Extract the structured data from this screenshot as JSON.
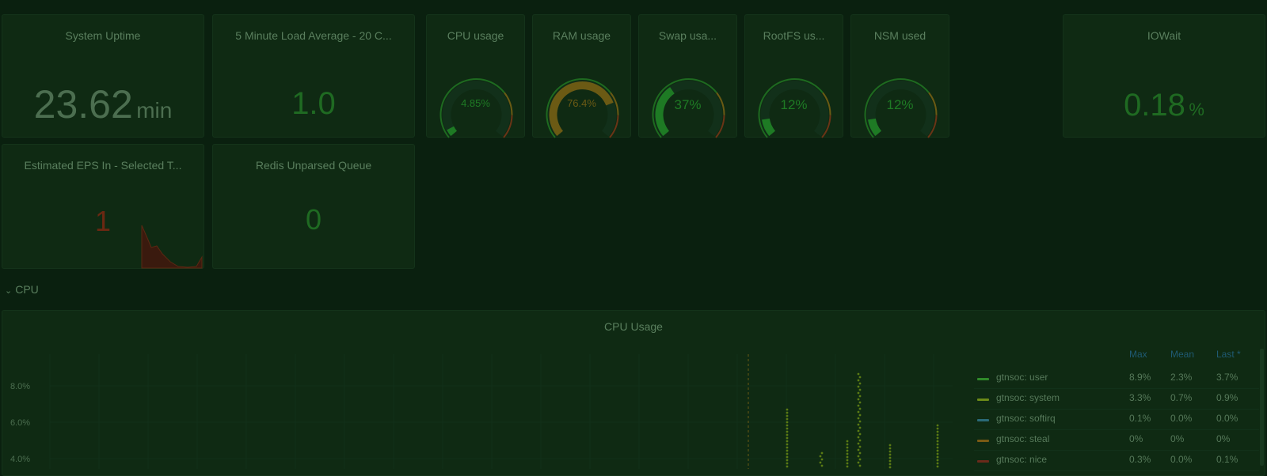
{
  "stats": {
    "uptime": {
      "title": "System Uptime",
      "value": "23.62",
      "unit": "min"
    },
    "load": {
      "title": "5 Minute Load Average - 20 C...",
      "value": "1.0"
    },
    "iowait": {
      "title": "IOWait",
      "value": "0.18",
      "unit": "%"
    },
    "eps": {
      "title": "Estimated EPS In - Selected T...",
      "value": "1"
    },
    "redis": {
      "title": "Redis Unparsed Queue",
      "value": "0"
    }
  },
  "gauges": [
    {
      "title": "CPU usage",
      "value": "4.85%",
      "level": 0.0485,
      "color": "#1e7a24"
    },
    {
      "title": "RAM usage",
      "value": "76.4%",
      "level": 0.764,
      "color": "#6b5a14"
    },
    {
      "title": "Swap usa...",
      "value": "37%",
      "level": 0.37,
      "color": "#1e7a24"
    },
    {
      "title": "RootFS us...",
      "value": "12%",
      "level": 0.12,
      "color": "#1e7a24"
    },
    {
      "title": "NSM used",
      "value": "12%",
      "level": 0.12,
      "color": "#1e7a24"
    }
  ],
  "row": {
    "label": "CPU"
  },
  "chart": {
    "title": "CPU Usage"
  },
  "chart_data": {
    "type": "line",
    "title": "CPU Usage",
    "y_ticks": [
      "8.0%",
      "6.0%",
      "4.0%"
    ],
    "series": [
      {
        "name": "gtnsoc: user",
        "color": "#2f8a2a",
        "max": "8.9%",
        "mean": "2.3%",
        "last": "3.7%"
      },
      {
        "name": "gtnsoc: system",
        "color": "#6c8a18",
        "max": "3.3%",
        "mean": "0.7%",
        "last": "0.9%"
      },
      {
        "name": "gtnsoc: softirq",
        "color": "#2a6a78",
        "max": "0.1%",
        "mean": "0.0%",
        "last": "0.0%"
      },
      {
        "name": "gtnsoc: steal",
        "color": "#7a5a14",
        "max": "0%",
        "mean": "0%",
        "last": "0%"
      },
      {
        "name": "gtnsoc: nice",
        "color": "#6a2a1a",
        "max": "0.3%",
        "mean": "0.0%",
        "last": "0.1%"
      }
    ]
  },
  "legend": {
    "max_label": "Max",
    "mean_label": "Mean",
    "last_label": "Last *"
  }
}
